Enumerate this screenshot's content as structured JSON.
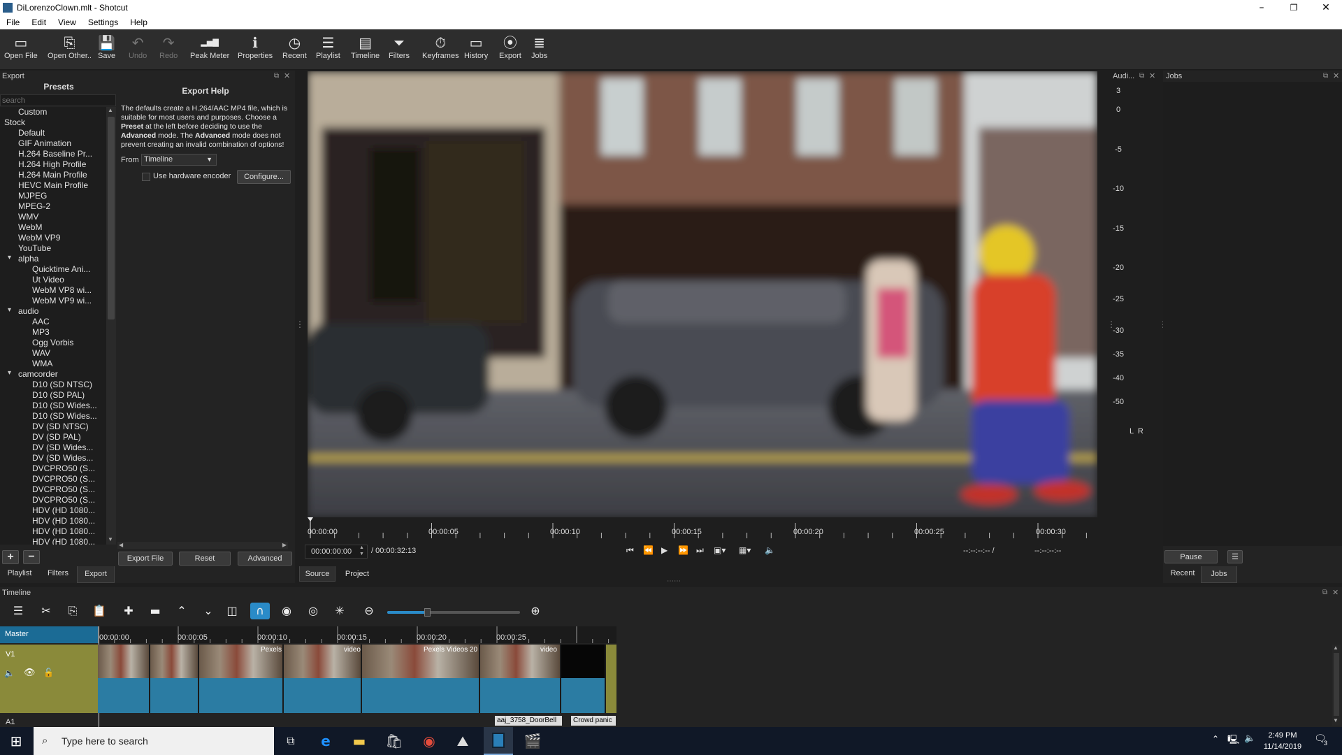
{
  "window": {
    "title": "DiLorenzoClown.mlt - Shotcut",
    "controls": [
      "–",
      "❐",
      "✕"
    ]
  },
  "menu": [
    "File",
    "Edit",
    "View",
    "Settings",
    "Help"
  ],
  "toolbar": [
    {
      "label": "Open File",
      "icon": "open-file-icon",
      "glyph": "▭",
      "enabled": true
    },
    {
      "label": "Open Other..",
      "icon": "open-other-icon",
      "glyph": "⎘",
      "enabled": true
    },
    {
      "label": "Save",
      "icon": "save-icon",
      "glyph": "💾",
      "enabled": true
    },
    {
      "label": "Undo",
      "icon": "undo-icon",
      "glyph": "↶",
      "enabled": false
    },
    {
      "label": "Redo",
      "icon": "redo-icon",
      "glyph": "↷",
      "enabled": false
    },
    {
      "label": "Peak Meter",
      "icon": "peak-meter-icon",
      "glyph": "▂▅▇",
      "enabled": true
    },
    {
      "label": "Properties",
      "icon": "properties-icon",
      "glyph": "ℹ",
      "enabled": true
    },
    {
      "label": "Recent",
      "icon": "recent-icon",
      "glyph": "◷",
      "enabled": true
    },
    {
      "label": "Playlist",
      "icon": "playlist-icon",
      "glyph": "☰",
      "enabled": true
    },
    {
      "label": "Timeline",
      "icon": "timeline-icon",
      "glyph": "▤",
      "enabled": true
    },
    {
      "label": "Filters",
      "icon": "filters-icon",
      "glyph": "⏷",
      "enabled": true
    },
    {
      "label": "Keyframes",
      "icon": "keyframes-icon",
      "glyph": "⏱",
      "enabled": true
    },
    {
      "label": "History",
      "icon": "history-icon",
      "glyph": "▭",
      "enabled": true
    },
    {
      "label": "Export",
      "icon": "export-icon",
      "glyph": "⦿",
      "enabled": true
    },
    {
      "label": "Jobs",
      "icon": "jobs-icon",
      "glyph": "≣",
      "enabled": true
    }
  ],
  "export_panel": {
    "title": "Export",
    "presets_heading": "Presets",
    "search_placeholder": "search",
    "tree": [
      {
        "label": "Custom",
        "level": 1
      },
      {
        "label": "Stock",
        "level": 0,
        "expander": "▾"
      },
      {
        "label": "Default",
        "level": 1
      },
      {
        "label": "GIF Animation",
        "level": 1
      },
      {
        "label": "H.264 Baseline Pr...",
        "level": 1
      },
      {
        "label": "H.264 High Profile",
        "level": 1
      },
      {
        "label": "H.264 Main Profile",
        "level": 1
      },
      {
        "label": "HEVC Main Profile",
        "level": 1
      },
      {
        "label": "MJPEG",
        "level": 1
      },
      {
        "label": "MPEG-2",
        "level": 1
      },
      {
        "label": "WMV",
        "level": 1
      },
      {
        "label": "WebM",
        "level": 1
      },
      {
        "label": "WebM VP9",
        "level": 1
      },
      {
        "label": "YouTube",
        "level": 1
      },
      {
        "label": "alpha",
        "level": 1,
        "expander": "▾"
      },
      {
        "label": "Quicktime Ani...",
        "level": 2
      },
      {
        "label": "Ut Video",
        "level": 2
      },
      {
        "label": "WebM VP8 wi...",
        "level": 2
      },
      {
        "label": "WebM VP9 wi...",
        "level": 2
      },
      {
        "label": "audio",
        "level": 1,
        "expander": "▾"
      },
      {
        "label": "AAC",
        "level": 2
      },
      {
        "label": "MP3",
        "level": 2
      },
      {
        "label": "Ogg Vorbis",
        "level": 2
      },
      {
        "label": "WAV",
        "level": 2
      },
      {
        "label": "WMA",
        "level": 2
      },
      {
        "label": "camcorder",
        "level": 1,
        "expander": "▾"
      },
      {
        "label": "D10 (SD NTSC)",
        "level": 2
      },
      {
        "label": "D10 (SD PAL)",
        "level": 2
      },
      {
        "label": "D10 (SD Wides...",
        "level": 2
      },
      {
        "label": "D10 (SD Wides...",
        "level": 2
      },
      {
        "label": "DV (SD NTSC)",
        "level": 2
      },
      {
        "label": "DV (SD PAL)",
        "level": 2
      },
      {
        "label": "DV (SD Wides...",
        "level": 2
      },
      {
        "label": "DV (SD Wides...",
        "level": 2
      },
      {
        "label": "DVCPRO50 (S...",
        "level": 2
      },
      {
        "label": "DVCPRO50 (S...",
        "level": 2
      },
      {
        "label": "DVCPRO50 (S...",
        "level": 2
      },
      {
        "label": "DVCPRO50 (S...",
        "level": 2
      },
      {
        "label": "HDV (HD 1080...",
        "level": 2
      },
      {
        "label": "HDV (HD 1080...",
        "level": 2
      },
      {
        "label": "HDV (HD 1080...",
        "level": 2
      },
      {
        "label": "HDV (HD 1080...",
        "level": 2
      }
    ],
    "help_heading": "Export Help",
    "help_text_html": "The defaults create a H.264/AAC MP4 file, which is suitable for most users and purposes. Choose a <b>Preset</b> at the left before deciding to use the <b>Advanced</b> mode. The <b>Advanced</b> mode does not prevent creating an invalid combination of options!",
    "from_label": "From",
    "from_value": "Timeline",
    "hw_encoder_label": "Use hardware encoder",
    "configure_label": "Configure...",
    "export_file_label": "Export File",
    "reset_label": "Reset",
    "advanced_label": "Advanced",
    "tabs": [
      "Playlist",
      "Filters",
      "Export"
    ]
  },
  "player": {
    "ruler_labels": [
      "00:00:00",
      "00:00:05",
      "00:00:10",
      "00:00:15",
      "00:00:20",
      "00:00:25",
      "00:00:30"
    ],
    "position": "00:00:00:00",
    "duration": "/ 00:00:32:13",
    "in_point": "--:--:--:-- /",
    "out_point": "--:--:--:--",
    "tabs": [
      "Source",
      "Project"
    ]
  },
  "audio_meter": {
    "title": "Audi...",
    "scale": [
      "3",
      "0",
      "-5",
      "-10",
      "-15",
      "-20",
      "-25",
      "-30",
      "-35",
      "-40",
      "-50"
    ],
    "channels": "L  R"
  },
  "jobs_panel": {
    "title": "Jobs",
    "pause_label": "Pause",
    "menu_glyph": "☰",
    "tabs": [
      "Recent",
      "Jobs"
    ]
  },
  "timeline": {
    "title": "Timeline",
    "tools": [
      {
        "icon": "menu-icon",
        "glyph": "☰"
      },
      {
        "icon": "cut-icon",
        "glyph": "✂"
      },
      {
        "icon": "copy-icon",
        "glyph": "⎘"
      },
      {
        "icon": "paste-icon",
        "glyph": "📋"
      },
      {
        "icon": "append-icon",
        "glyph": "✚"
      },
      {
        "icon": "remove-icon",
        "glyph": "▬"
      },
      {
        "icon": "lift-icon",
        "glyph": "⌃"
      },
      {
        "icon": "overwrite-icon",
        "glyph": "⌄"
      },
      {
        "icon": "split-icon",
        "glyph": "◫"
      },
      {
        "icon": "snap-icon",
        "glyph": "∩"
      },
      {
        "icon": "scrub-icon",
        "glyph": "◉"
      },
      {
        "icon": "ripple-icon",
        "glyph": "◎"
      },
      {
        "icon": "ripple-all-icon",
        "glyph": "✳"
      },
      {
        "icon": "zoom-out-icon",
        "glyph": "⊖"
      },
      {
        "icon": "zoom-in-icon",
        "glyph": "⊕"
      }
    ],
    "zoom_level": 0.3,
    "master_label": "Master",
    "v1_label": "V1",
    "a1_label": "A1",
    "ruler_labels": [
      "00:00:00",
      "00:00:05",
      "00:00:10",
      "00:00:15",
      "00:00:20",
      "00:00:25"
    ],
    "clip_labels": [
      "Pexels",
      "video",
      "Pexels Videos 20",
      "video"
    ],
    "audio_clips": [
      "aaj_3758_DoorBell",
      "Crowd panic"
    ]
  },
  "taskbar": {
    "search_placeholder": "Type here to search",
    "time": "2:49 PM",
    "date": "11/14/2019",
    "notification_count": "3"
  }
}
